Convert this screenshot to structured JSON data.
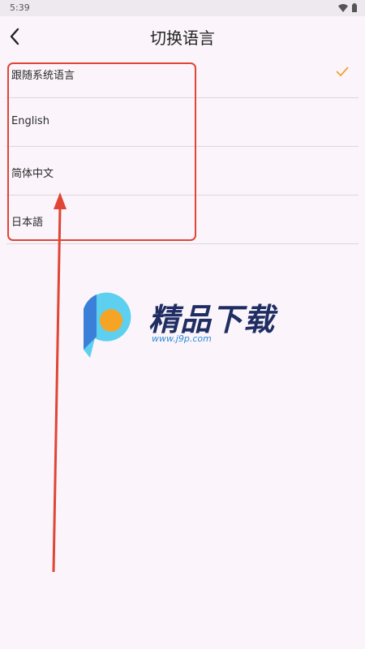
{
  "status_bar": {
    "time": "5:39"
  },
  "header": {
    "title": "切换语言"
  },
  "languages": [
    {
      "label": "跟随系统语言",
      "selected": true
    },
    {
      "label": "English",
      "selected": false
    },
    {
      "label": "简体中文",
      "selected": false
    },
    {
      "label": "日本語",
      "selected": false
    }
  ],
  "watermark": {
    "brand": "精品下载",
    "url": "www.j9p.com"
  },
  "colors": {
    "accent": "#f0a030",
    "annotation": "#e04535",
    "background": "#fbf5fb"
  }
}
